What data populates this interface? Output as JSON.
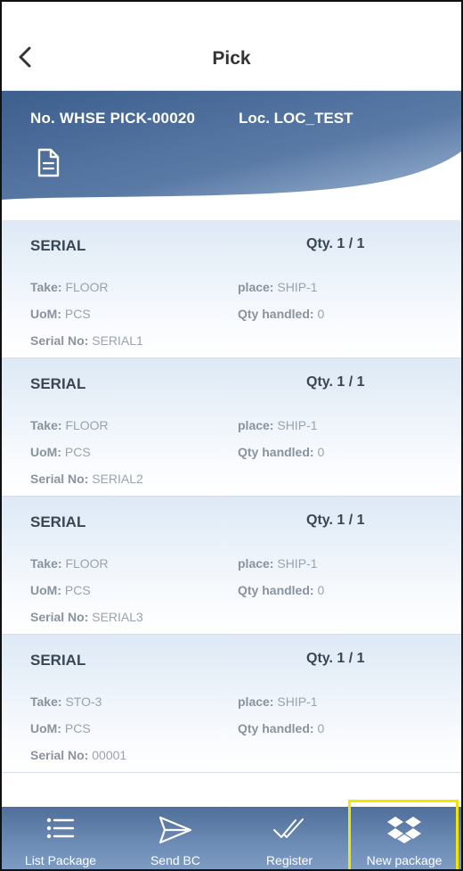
{
  "header": {
    "title": "Pick"
  },
  "banner": {
    "number": "No. WHSE PICK-00020",
    "location": "Loc. LOC_TEST"
  },
  "labels": {
    "take": "Take:",
    "uom": "UoM:",
    "serial_no": "Serial No:",
    "place": "place:",
    "qty_handled": "Qty handled:"
  },
  "lines": [
    {
      "item": "SERIAL",
      "qty": "Qty. 1 / 1",
      "take": "FLOOR",
      "place": "SHIP-1",
      "uom": "PCS",
      "qty_handled": "0",
      "serial_no": "SERIAL1"
    },
    {
      "item": "SERIAL",
      "qty": "Qty. 1 / 1",
      "take": "FLOOR",
      "place": "SHIP-1",
      "uom": "PCS",
      "qty_handled": "0",
      "serial_no": "SERIAL2"
    },
    {
      "item": "SERIAL",
      "qty": "Qty. 1 / 1",
      "take": "FLOOR",
      "place": "SHIP-1",
      "uom": "PCS",
      "qty_handled": "0",
      "serial_no": "SERIAL3"
    },
    {
      "item": "SERIAL",
      "qty": "Qty. 1 / 1",
      "take": "STO-3",
      "place": "SHIP-1",
      "uom": "PCS",
      "qty_handled": "0",
      "serial_no": "00001"
    }
  ],
  "bottom_nav": [
    {
      "label": "List Package",
      "icon": "list-icon"
    },
    {
      "label": "Send BC",
      "icon": "send-icon"
    },
    {
      "label": "Register",
      "icon": "double-check-icon"
    },
    {
      "label": "New package",
      "icon": "dropbox-icon"
    }
  ],
  "colors": {
    "banner": "#4f6e99",
    "nav": "#6d8cb6",
    "highlight": "#f2e500",
    "card_top": "#dde9f5"
  }
}
